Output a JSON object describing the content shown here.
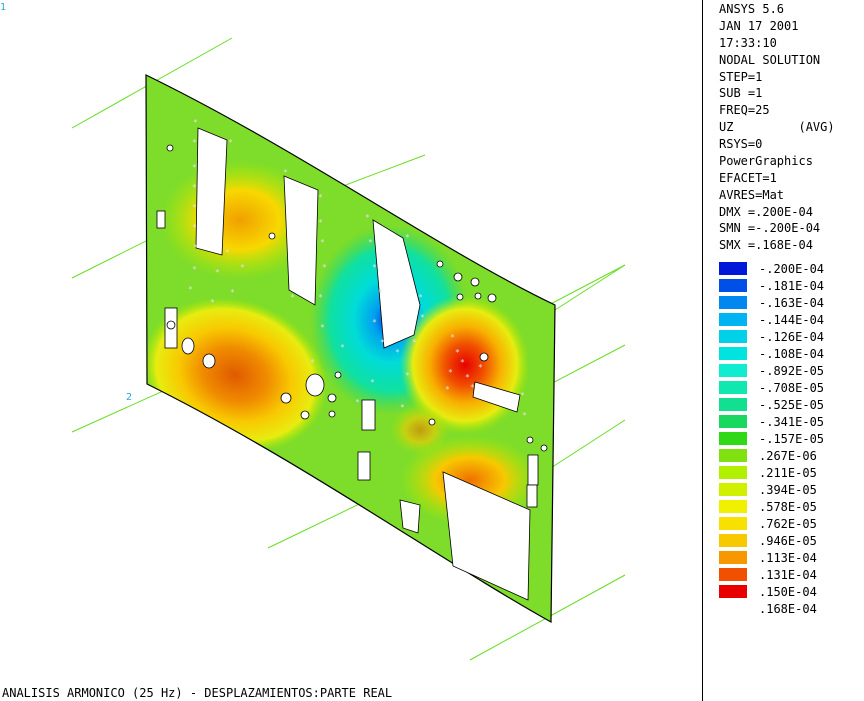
{
  "header": {
    "program": "ANSYS 5.6",
    "date": "JAN 17 2001",
    "time": "17:33:10",
    "solution": "NODAL SOLUTION",
    "step": "STEP=1",
    "sub": "SUB =1",
    "freq": "FREQ=25",
    "component": "UZ         (AVG)",
    "rsys": "RSYS=0",
    "graphics": "PowerGraphics",
    "efacet": "EFACET=1",
    "avres": "AVRES=Mat",
    "dmx": "DMX =.200E-04",
    "smn": "SMN =-.200E-04",
    "smx": "SMX =.168E-04"
  },
  "legend": {
    "levels": [
      {
        "label": "-.200E-04",
        "color": "#0018d8"
      },
      {
        "label": "-.181E-04",
        "color": "#0050e8"
      },
      {
        "label": "-.163E-04",
        "color": "#0088f0"
      },
      {
        "label": "-.144E-04",
        "color": "#00b4f4"
      },
      {
        "label": "-.126E-04",
        "color": "#00d0e8"
      },
      {
        "label": "-.108E-04",
        "color": "#00e4e0"
      },
      {
        "label": "-.892E-05",
        "color": "#10ecd0"
      },
      {
        "label": "-.708E-05",
        "color": "#10e8b0"
      },
      {
        "label": "-.525E-05",
        "color": "#10e090"
      },
      {
        "label": "-.341E-05",
        "color": "#18d860"
      },
      {
        "label": "-.157E-05",
        "color": "#30d818"
      },
      {
        "label": ".267E-06",
        "color": "#80e010"
      },
      {
        "label": ".211E-05",
        "color": "#b0f000"
      },
      {
        "label": ".394E-05",
        "color": "#d0f000"
      },
      {
        "label": ".578E-05",
        "color": "#f0f000"
      },
      {
        "label": ".762E-05",
        "color": "#f8e000"
      },
      {
        "label": ".946E-05",
        "color": "#f8c800"
      },
      {
        "label": ".113E-04",
        "color": "#f89800"
      },
      {
        "label": ".131E-04",
        "color": "#f05000"
      },
      {
        "label": ".150E-04",
        "color": "#e80000"
      }
    ],
    "max_label": ".168E-04"
  },
  "axis_tags": {
    "corner": "1",
    "z": "2"
  },
  "caption": "ANALISIS ARMONICO (25 Hz) - DESPLAZAMIENTOS:PARTE REAL",
  "colors": {
    "background": "#ffffff",
    "plate_base": "#7edc2a",
    "boundary_line": "#66dd22"
  },
  "icons": [
    "node-marker-star"
  ]
}
